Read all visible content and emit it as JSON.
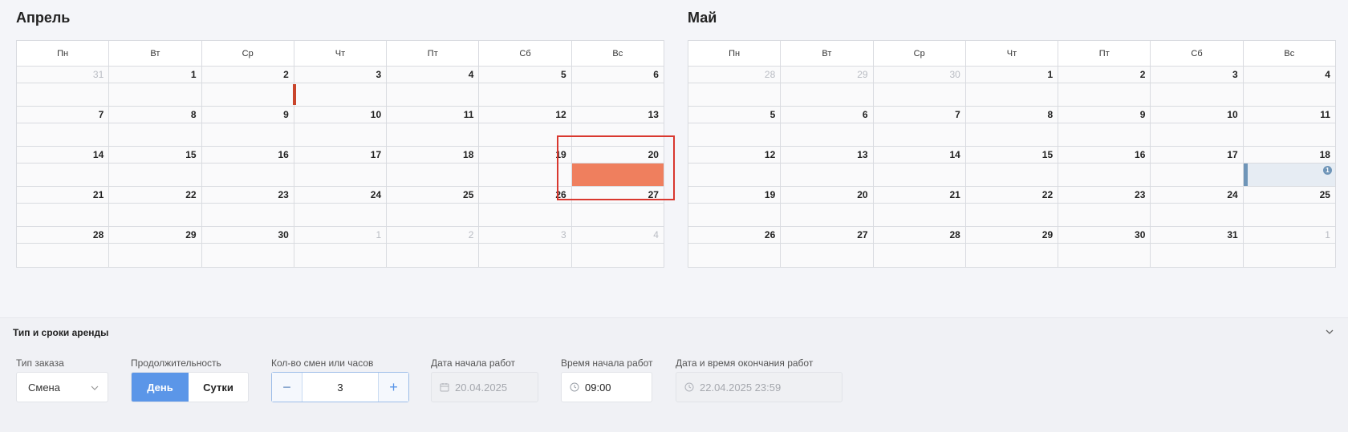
{
  "weekdays": [
    "Пн",
    "Вт",
    "Ср",
    "Чт",
    "Пт",
    "Сб",
    "Вс"
  ],
  "april": {
    "title": "Апрель",
    "weeks": [
      [
        "31",
        "1",
        "2",
        "3",
        "4",
        "5",
        "6"
      ],
      [
        "7",
        "8",
        "9",
        "10",
        "11",
        "12",
        "13"
      ],
      [
        "14",
        "15",
        "16",
        "17",
        "18",
        "19",
        "20"
      ],
      [
        "21",
        "22",
        "23",
        "24",
        "25",
        "26",
        "27"
      ],
      [
        "28",
        "29",
        "30",
        "1",
        "2",
        "3",
        "4"
      ]
    ]
  },
  "may": {
    "title": "Май",
    "weeks": [
      [
        "28",
        "29",
        "30",
        "1",
        "2",
        "3",
        "4"
      ],
      [
        "5",
        "6",
        "7",
        "8",
        "9",
        "10",
        "11"
      ],
      [
        "12",
        "13",
        "14",
        "15",
        "16",
        "17",
        "18"
      ],
      [
        "19",
        "20",
        "21",
        "22",
        "23",
        "24",
        "25"
      ],
      [
        "26",
        "27",
        "28",
        "29",
        "30",
        "31",
        "1"
      ]
    ],
    "event_badge": "1"
  },
  "colors": {
    "accent": "#5b96e8",
    "booking_orange": "#ef7f5e",
    "booking_red": "#c9452c",
    "booking_blue": "#6f95b8",
    "highlight": "#d9382f"
  },
  "panel": {
    "title": "Тип и сроки аренды",
    "order_type": {
      "label": "Тип заказа",
      "value": "Смена"
    },
    "duration": {
      "label": "Продолжительность",
      "options": [
        "День",
        "Сутки"
      ],
      "selected": "День"
    },
    "shifts": {
      "label": "Кол-во смен или часов",
      "value": "3",
      "minus": "−",
      "plus": "+"
    },
    "start_date": {
      "label": "Дата начала работ",
      "value": "20.04.2025"
    },
    "start_time": {
      "label": "Время начала работ",
      "value": "09:00"
    },
    "end_datetime": {
      "label": "Дата и время окончания работ",
      "value": "22.04.2025 23:59"
    }
  }
}
